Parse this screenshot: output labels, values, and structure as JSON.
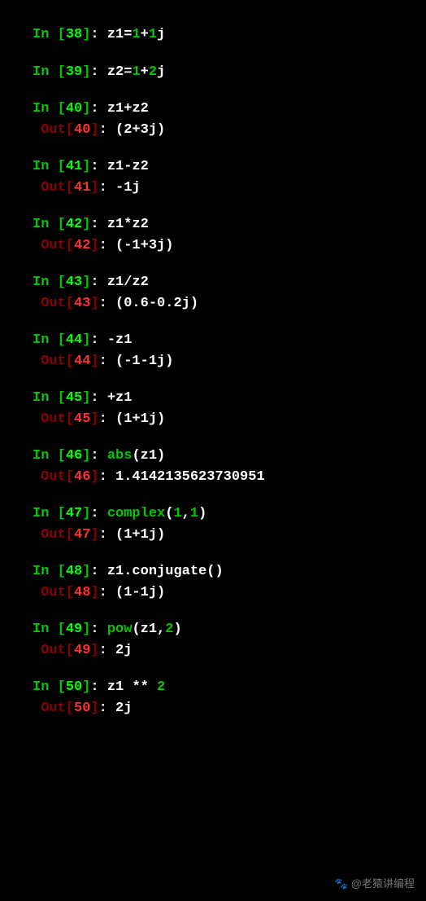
{
  "cells": [
    {
      "in_num": "38",
      "code_tokens": [
        {
          "t": "z1",
          "c": "code"
        },
        {
          "t": "=",
          "c": "op"
        },
        {
          "t": "1",
          "c": "int"
        },
        {
          "t": "+",
          "c": "op"
        },
        {
          "t": "1",
          "c": "int"
        },
        {
          "t": "j",
          "c": "code"
        }
      ],
      "out_num": null,
      "output": null
    },
    {
      "in_num": "39",
      "code_tokens": [
        {
          "t": "z2",
          "c": "code"
        },
        {
          "t": "=",
          "c": "op"
        },
        {
          "t": "1",
          "c": "int"
        },
        {
          "t": "+",
          "c": "op"
        },
        {
          "t": "2",
          "c": "int"
        },
        {
          "t": "j",
          "c": "code"
        }
      ],
      "out_num": null,
      "output": null
    },
    {
      "in_num": "40",
      "code_tokens": [
        {
          "t": "z1",
          "c": "code"
        },
        {
          "t": "+",
          "c": "op"
        },
        {
          "t": "z2",
          "c": "code"
        }
      ],
      "out_num": "40",
      "output": "(2+3j)"
    },
    {
      "in_num": "41",
      "code_tokens": [
        {
          "t": "z1",
          "c": "code"
        },
        {
          "t": "-",
          "c": "op"
        },
        {
          "t": "z2",
          "c": "code"
        }
      ],
      "out_num": "41",
      "output": "-1j"
    },
    {
      "in_num": "42",
      "code_tokens": [
        {
          "t": "z1",
          "c": "code"
        },
        {
          "t": "*",
          "c": "op"
        },
        {
          "t": "z2",
          "c": "code"
        }
      ],
      "out_num": "42",
      "output": "(-1+3j)"
    },
    {
      "in_num": "43",
      "code_tokens": [
        {
          "t": "z1",
          "c": "code"
        },
        {
          "t": "/",
          "c": "op"
        },
        {
          "t": "z2",
          "c": "code"
        }
      ],
      "out_num": "43",
      "output": "(0.6-0.2j)"
    },
    {
      "in_num": "44",
      "code_tokens": [
        {
          "t": "-",
          "c": "op"
        },
        {
          "t": "z1",
          "c": "code"
        }
      ],
      "out_num": "44",
      "output": "(-1-1j)"
    },
    {
      "in_num": "45",
      "code_tokens": [
        {
          "t": "+",
          "c": "op"
        },
        {
          "t": "z1",
          "c": "code"
        }
      ],
      "out_num": "45",
      "output": "(1+1j)"
    },
    {
      "in_num": "46",
      "code_tokens": [
        {
          "t": "abs",
          "c": "func"
        },
        {
          "t": "(z1)",
          "c": "code"
        }
      ],
      "out_num": "46",
      "output": "1.4142135623730951"
    },
    {
      "in_num": "47",
      "code_tokens": [
        {
          "t": "complex",
          "c": "func"
        },
        {
          "t": "(",
          "c": "code"
        },
        {
          "t": "1",
          "c": "int"
        },
        {
          "t": ",",
          "c": "code"
        },
        {
          "t": "1",
          "c": "int"
        },
        {
          "t": ")",
          "c": "code"
        }
      ],
      "out_num": "47",
      "output": "(1+1j)"
    },
    {
      "in_num": "48",
      "code_tokens": [
        {
          "t": "z1.conjugate()",
          "c": "code"
        }
      ],
      "out_num": "48",
      "output": "(1-1j)"
    },
    {
      "in_num": "49",
      "code_tokens": [
        {
          "t": "pow",
          "c": "func"
        },
        {
          "t": "(z1,",
          "c": "code"
        },
        {
          "t": "2",
          "c": "int"
        },
        {
          "t": ")",
          "c": "code"
        }
      ],
      "out_num": "49",
      "output": "2j"
    },
    {
      "in_num": "50",
      "code_tokens": [
        {
          "t": "z1 ",
          "c": "code"
        },
        {
          "t": "**",
          "c": "op"
        },
        {
          "t": " ",
          "c": "code"
        },
        {
          "t": "2",
          "c": "int"
        }
      ],
      "out_num": "50",
      "output": "2j"
    }
  ],
  "watermark": "@老猿讲编程"
}
